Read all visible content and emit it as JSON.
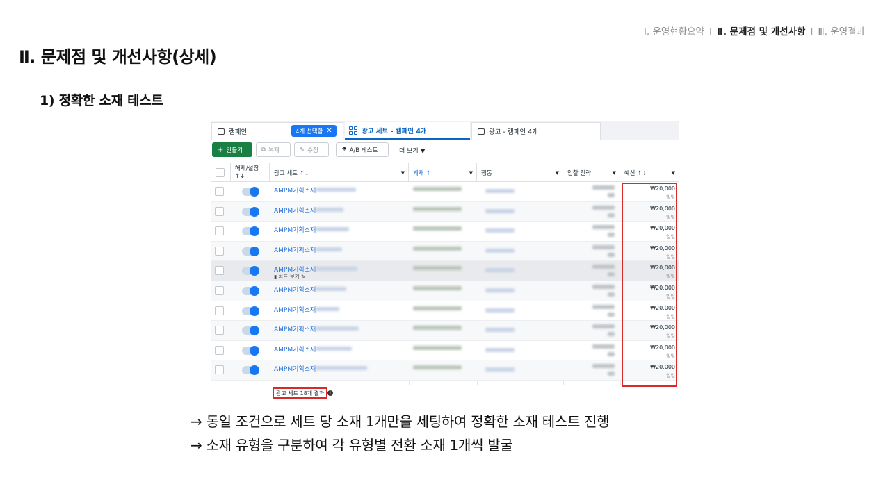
{
  "breadcrumb": {
    "items": [
      "Ⅰ. 운영현황요약",
      "Ⅱ. 문제점 및 개선사항",
      "Ⅲ. 운영결과"
    ],
    "separators": [
      "I",
      "I"
    ]
  },
  "page_title": "Ⅱ. 문제점 및 개선사항(상세)",
  "section_title": "1) 정확한 소재 테스트",
  "screenshot": {
    "tabs": {
      "campaign": "캠페인",
      "selected_badge": "4개 선택함",
      "adset": "광고 세트 - 캠페인 4개",
      "ad": "광고 - 캠페인 4개"
    },
    "toolbar": {
      "create": "만들기",
      "copy": "복제",
      "edit": "수정",
      "ab_test": "A/B 테스트",
      "more": "더 보기"
    },
    "columns": {
      "onoff": "해제/설정 ↑↓",
      "adset": "광고 세트 ↑↓",
      "delivery": "게재 ↑",
      "action": "행동",
      "bid": "입찰 전략",
      "budget": "예산 ↑↓"
    },
    "row_name_prefix": "AMPM기획소재",
    "row_subline": "차트 보기",
    "budget_value": "₩20,000",
    "budget_period": "일일",
    "rows": [
      {
        "name": "AMPM기획소재",
        "budget": "₩20,000",
        "period": "일일"
      },
      {
        "name": "AMPM기획소재",
        "budget": "₩20,000",
        "period": "일일"
      },
      {
        "name": "AMPM기획소재",
        "budget": "₩20,000",
        "period": "일일"
      },
      {
        "name": "AMPM기획소재",
        "budget": "₩20,000",
        "period": "일일"
      },
      {
        "name": "AMPM기획소재",
        "budget": "₩20,000",
        "period": "일일",
        "sub": "차트 보기"
      },
      {
        "name": "AMPM기획소재",
        "budget": "₩20,000",
        "period": "일일"
      },
      {
        "name": "AMPM기획소재",
        "budget": "₩20,000",
        "period": "일일"
      },
      {
        "name": "AMPM기획소재",
        "budget": "₩20,000",
        "period": "일일"
      },
      {
        "name": "AMPM기획소재",
        "budget": "₩20,000",
        "period": "일일"
      },
      {
        "name": "AMPM기획소재",
        "budget": "₩20,000",
        "period": "일일"
      }
    ],
    "result_count": "광고 세트 18개 결과"
  },
  "bullets": [
    "→ 동일 조건으로 세트 당 소재 1개만을 세팅하여 정확한 소재 테스트 진행",
    "→ 소재 유형을 구분하여 각 유형별 전환 소재 1개씩 발굴"
  ],
  "colors": {
    "highlight_box": "#d92a2a",
    "link_blue": "#216fdb",
    "create_green": "#1a7f43",
    "toggle_blue": "#1877f2"
  }
}
